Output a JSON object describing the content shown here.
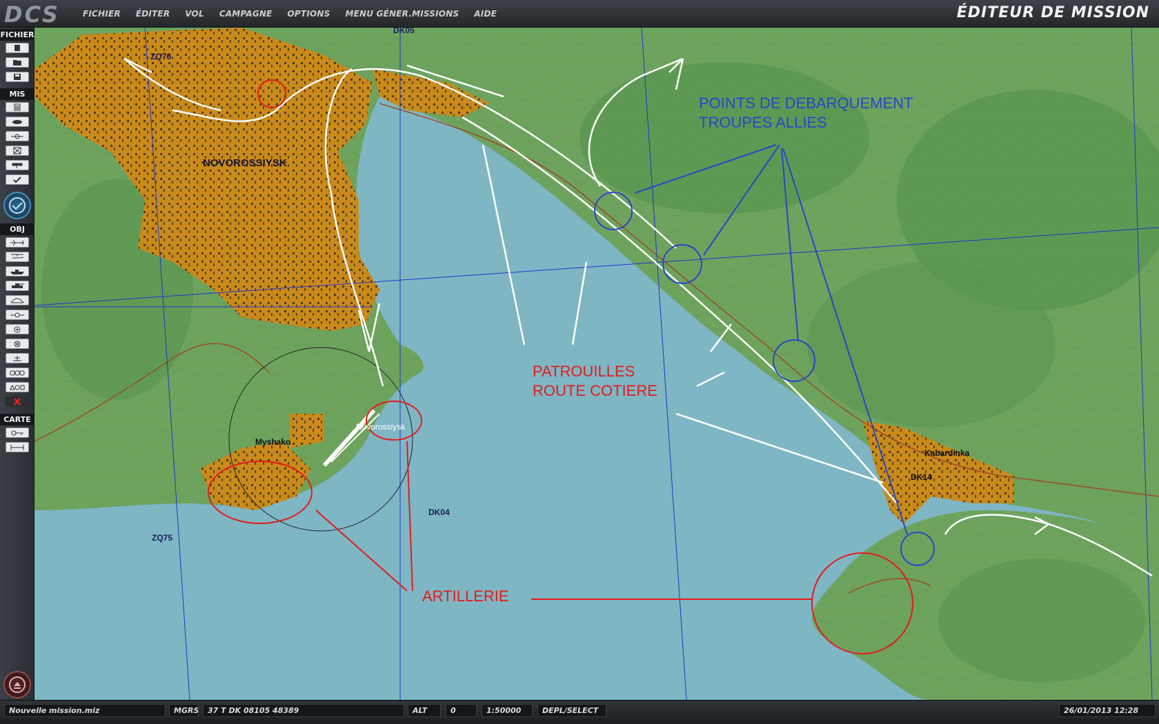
{
  "app": {
    "logo_text": "DCS",
    "title": "ÉDITEUR DE MISSION",
    "menu": [
      "FICHIER",
      "ÉDITER",
      "VOL",
      "CAMPAGNE",
      "OPTIONS",
      "MENU GÉNER.MISSIONS",
      "AIDE"
    ]
  },
  "toolbar": {
    "sections": {
      "file": "FICHIER",
      "mission": "MIS",
      "objects": "OBJ",
      "map": "CARTE"
    },
    "file_buttons": [
      "new-file-icon",
      "open-folder-icon",
      "save-disk-icon"
    ],
    "mission_buttons": [
      "briefing-icon",
      "weather-icon",
      "triggers-icon",
      "failures-icon",
      "goals-icon",
      "check-icon",
      "time-icon"
    ],
    "object_buttons": [
      "airplane-icon",
      "helicopter-icon",
      "ship-icon",
      "tank-icon",
      "static-object-icon",
      "waypoint-icon",
      "target-icon",
      "ignore-icon",
      "template-icon",
      "vehicle-group-icon",
      "shapes-icon",
      "delete-icon"
    ],
    "map_buttons": [
      "ruler-key-icon",
      "measure-icon"
    ]
  },
  "map": {
    "place_labels": {
      "city": "NOVOROSSIYSK",
      "airfield": "Novorossiysk",
      "myshako": "Myshako",
      "kabardinka": "Kabardinka",
      "grid_zq76": "ZQ76",
      "grid_dk05": "DK05",
      "grid_zq75": "ZQ75",
      "grid_dk04": "DK04",
      "grid_dk14": "DK14"
    },
    "annotations": {
      "landing_points": "POINTS DE DEBARQUEMENT\nTROUPES ALLIES",
      "patrols": "PATROUILLES\nROUTE COTIERE",
      "artillery": "ARTILLERIE"
    },
    "colors": {
      "sea": "#7fb6c4",
      "land": "#6ea35e",
      "forest": "#5c9952",
      "urban": "#c98a1a",
      "grid": "#2235c8",
      "annotation_blue": "#2b44c9",
      "annotation_red": "#e31b1b"
    }
  },
  "status": {
    "file": "Nouvelle mission.miz",
    "coord_system": "MGRS",
    "coordinates": "37 T DK 08105 48389",
    "alt_label": "ALT",
    "alt_value": "0",
    "scale": "1:50000",
    "mode": "DEPL/SELECT",
    "datetime": "26/01/2013 12:28"
  }
}
